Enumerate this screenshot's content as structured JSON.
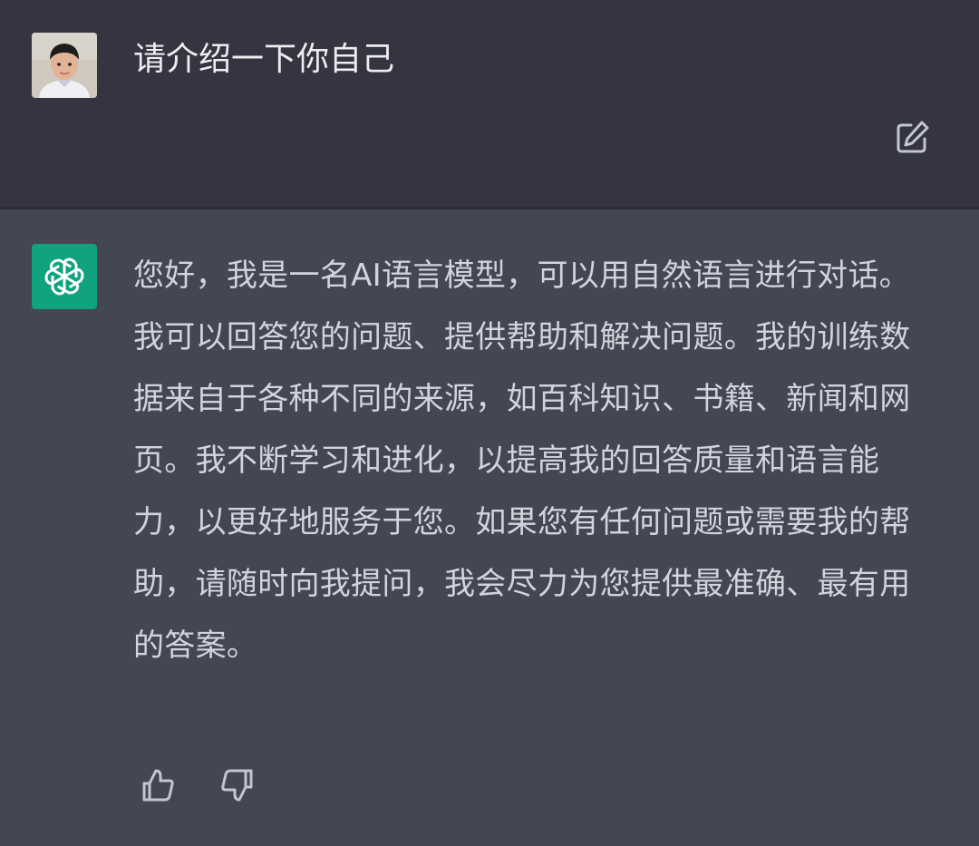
{
  "conversation": {
    "user": {
      "avatar_icon": "user-avatar",
      "message": "请介绍一下你自己"
    },
    "assistant": {
      "avatar_icon": "openai-logo-icon",
      "message": "您好，我是一名AI语言模型，可以用自然语言进行对话。我可以回答您的问题、提供帮助和解决问题。我的训练数据来自于各种不同的来源，如百科知识、书籍、新闻和网页。我不断学习和进化，以提高我的回答质量和语言能力，以更好地服务于您。如果您有任何问题或需要我的帮助，请随时向我提问，我会尽力为您提供最准确、最有用的答案。"
    }
  },
  "icons": {
    "edit": "edit-icon",
    "thumbs_up": "thumbs-up-icon",
    "thumbs_down": "thumbs-down-icon"
  },
  "colors": {
    "user_bg": "#343541",
    "assistant_bg": "#444654",
    "brand": "#10a37f",
    "text": "#ececf1",
    "icon": "#c5c5d2"
  }
}
